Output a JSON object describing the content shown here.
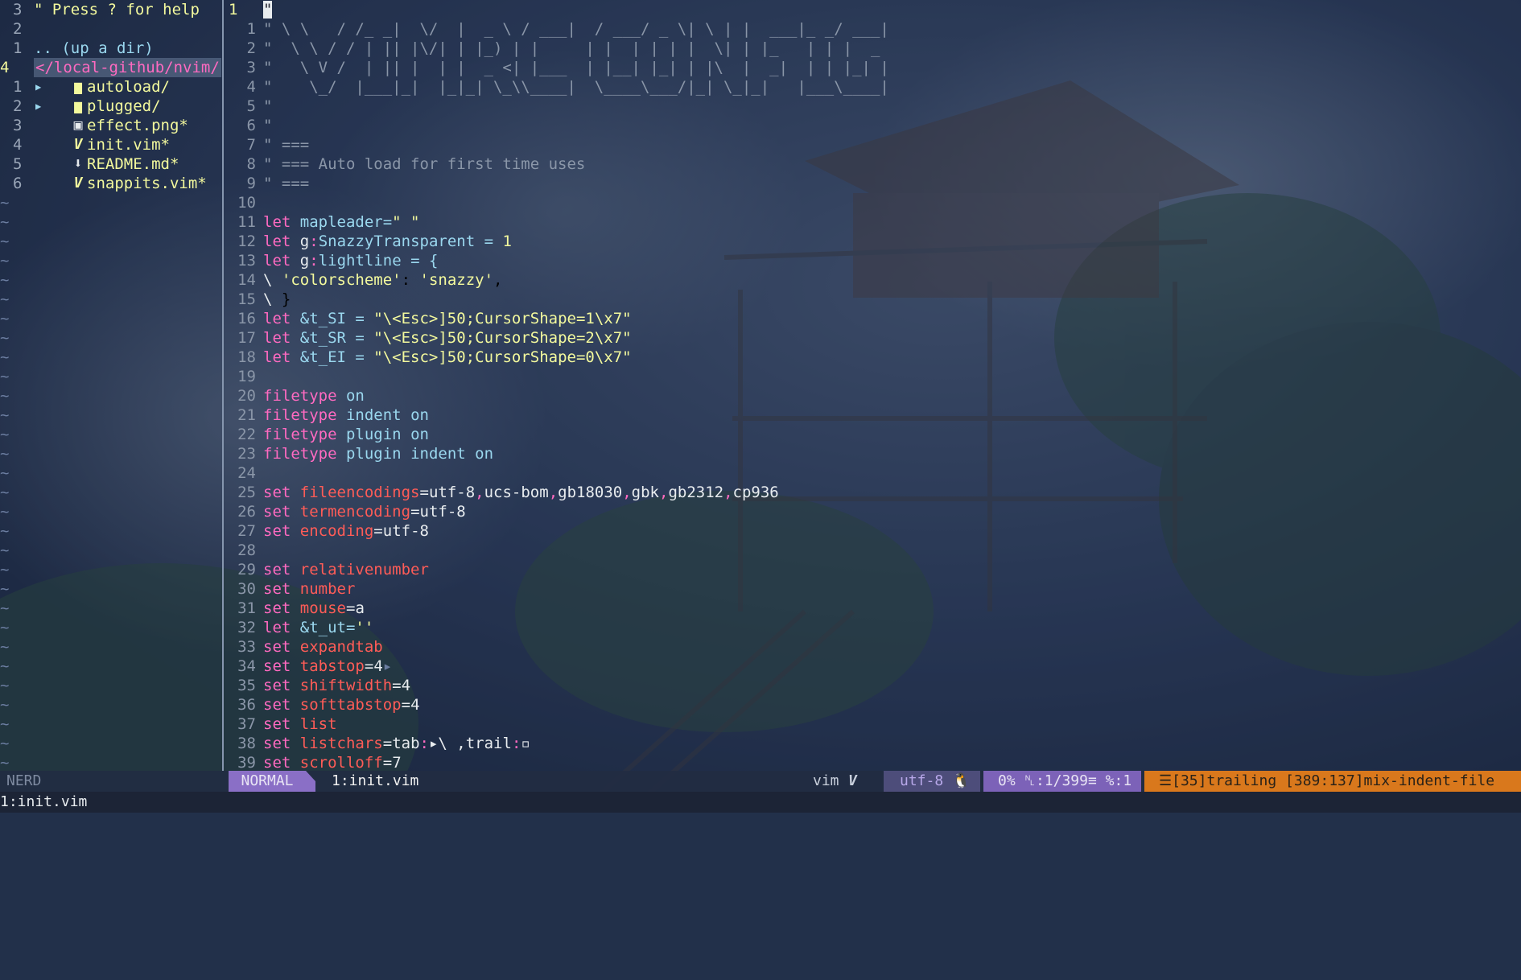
{
  "nerdtree": {
    "help": {
      "num": "3",
      "text": "\" Press ? for help"
    },
    "blank": {
      "num": "2"
    },
    "updir": {
      "num": "1",
      "text": ".. (up a dir)"
    },
    "root": {
      "num": "4",
      "text": "</local-github/nvim/"
    },
    "items": [
      {
        "num": "1",
        "name": "autoload/",
        "icon": "folder-icon",
        "glyph": "▶"
      },
      {
        "num": "2",
        "name": "plugged/",
        "icon": "folder-icon",
        "glyph": "▶"
      },
      {
        "num": "3",
        "name": "effect.png*",
        "icon": "image-icon"
      },
      {
        "num": "4",
        "name": "init.vim*",
        "icon": "vim-icon"
      },
      {
        "num": "5",
        "name": "README.md*",
        "icon": "download-icon"
      },
      {
        "num": "6",
        "name": "snappits.vim*",
        "icon": "vim-icon"
      }
    ],
    "tilde": "~"
  },
  "editor": {
    "current_line": "1",
    "cursor_char": "\"",
    "banner": [
      "\" \\ \\   / /_ _|  \\/  |  _ \\ / ___|  / ___/ _ \\| \\ | |  ___|_ _/ ___|",
      "\"  \\ \\ / / | || |\\/| | |_) | |     | |  | | | |  \\| | |_   | | |  _ ",
      "\"   \\ V /  | || |  | |  _ <| |___  | |__| |_| | |\\  |  _|  | | |_| |",
      "\"    \\_/  |___|_|  |_|_| \\_\\\\____|  \\____\\___/|_| \\_|_|   |___\\____|"
    ],
    "lines": [
      {
        "n": "5",
        "text": "\""
      },
      {
        "n": "6",
        "text": "\""
      },
      {
        "n": "7",
        "text": "\" ==="
      },
      {
        "n": "8",
        "text": "\" === Auto load for first time uses"
      },
      {
        "n": "9",
        "text": "\" ==="
      },
      {
        "n": "10",
        "text": ""
      },
      {
        "n": "11",
        "text": "let mapleader=\" \""
      },
      {
        "n": "12",
        "text": "let g:SnazzyTransparent = 1"
      },
      {
        "n": "13",
        "text": "let g:lightline = {"
      },
      {
        "n": "14",
        "text": "\\ 'colorscheme': 'snazzy',"
      },
      {
        "n": "15",
        "text": "\\ }"
      },
      {
        "n": "16",
        "text": "let &t_SI = \"\\<Esc>]50;CursorShape=1\\x7\""
      },
      {
        "n": "17",
        "text": "let &t_SR = \"\\<Esc>]50;CursorShape=2\\x7\""
      },
      {
        "n": "18",
        "text": "let &t_EI = \"\\<Esc>]50;CursorShape=0\\x7\""
      },
      {
        "n": "19",
        "text": ""
      },
      {
        "n": "20",
        "text": "filetype on"
      },
      {
        "n": "21",
        "text": "filetype indent on"
      },
      {
        "n": "22",
        "text": "filetype plugin on"
      },
      {
        "n": "23",
        "text": "filetype plugin indent on"
      },
      {
        "n": "24",
        "text": ""
      },
      {
        "n": "25",
        "text": "set fileencodings=utf-8,ucs-bom,gb18030,gbk,gb2312,cp936"
      },
      {
        "n": "26",
        "text": "set termencoding=utf-8"
      },
      {
        "n": "27",
        "text": "set encoding=utf-8"
      },
      {
        "n": "28",
        "text": ""
      },
      {
        "n": "29",
        "text": "set relativenumber"
      },
      {
        "n": "30",
        "text": "set number"
      },
      {
        "n": "31",
        "text": "set mouse=a"
      },
      {
        "n": "32",
        "text": "let &t_ut=''"
      },
      {
        "n": "33",
        "text": "set expandtab"
      },
      {
        "n": "34",
        "text": "set tabstop=4▸"
      },
      {
        "n": "35",
        "text": "set shiftwidth=4"
      },
      {
        "n": "36",
        "text": "set softtabstop=4"
      },
      {
        "n": "37",
        "text": "set list"
      },
      {
        "n": "38",
        "text": "set listchars=tab:▸\\ ,trail:▫"
      },
      {
        "n": "39",
        "text": "set scrolloff=7"
      }
    ]
  },
  "statusline": {
    "nerd_label": "NERD",
    "mode": "NORMAL",
    "file": "1:init.vim",
    "filetype": "vim",
    "filetype_icon": "vim-icon",
    "encoding": "utf-8",
    "os_icon": "linux-icon",
    "percent": "0%",
    "position": "1/399",
    "column": "1",
    "warnings": "☰[35]trailing [389:137]mix-indent-file"
  },
  "cmdline": "1:init.vim",
  "colors": {
    "pink": "#ff6ac1",
    "red": "#ff5c57",
    "yellow": "#f3f99d",
    "cyan": "#9ad7ee",
    "mode_purple": "#8a6fc6",
    "warning_orange": "#d9781c"
  }
}
